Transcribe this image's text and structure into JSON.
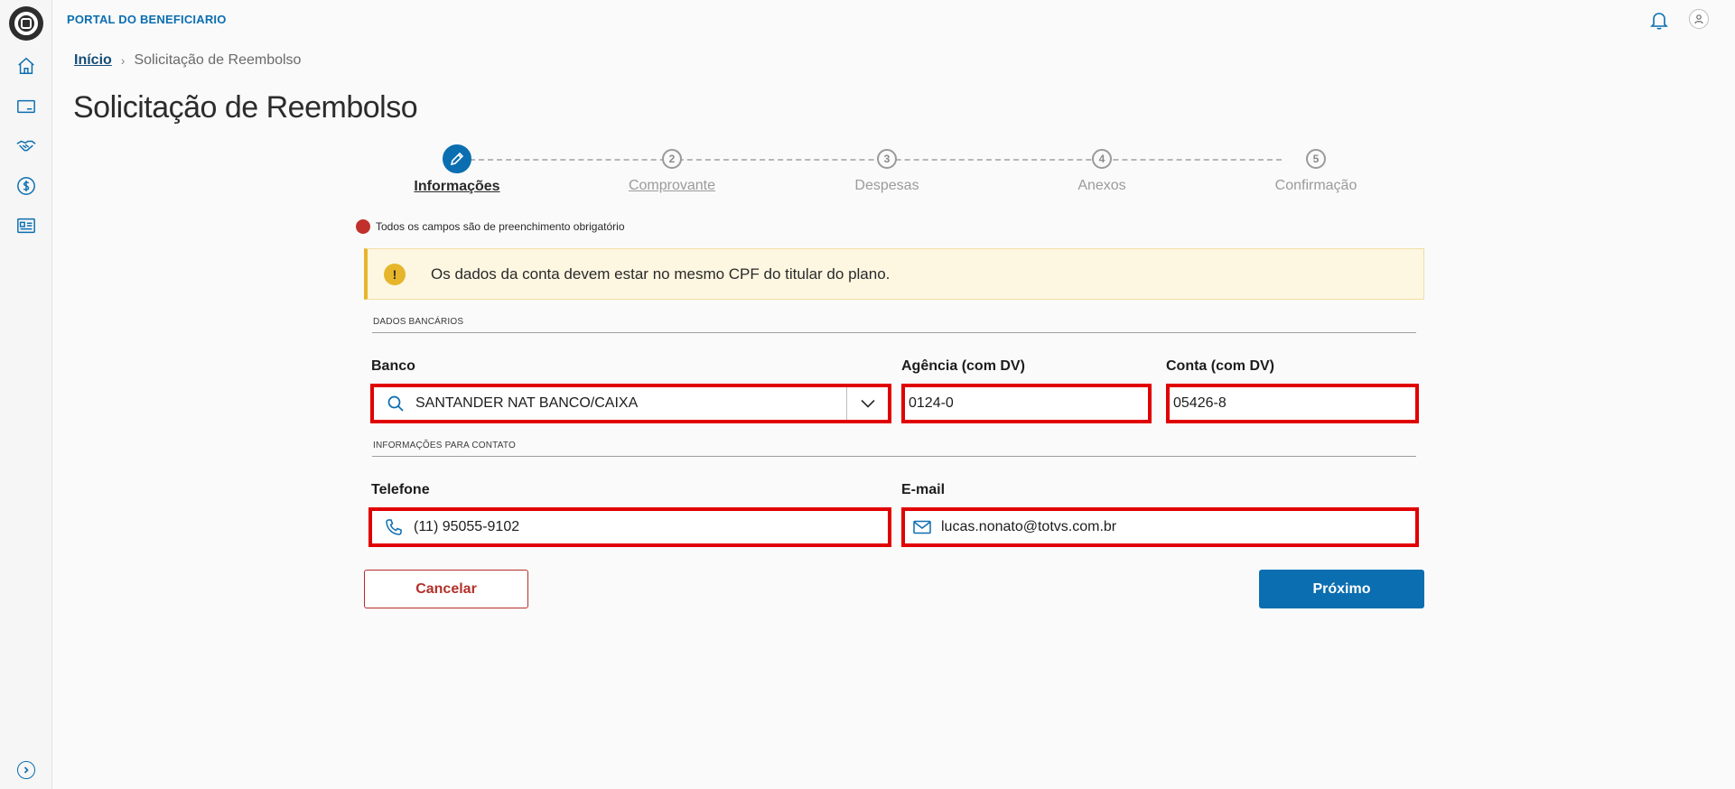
{
  "header": {
    "portal_title": "PORTAL DO BENEFICIARIO",
    "icons": [
      "logo-icon",
      "bell-icon",
      "user-icon"
    ]
  },
  "sidebar": {
    "items": [
      {
        "icon": "home-icon"
      },
      {
        "icon": "card-icon"
      },
      {
        "icon": "handshake-icon"
      },
      {
        "icon": "dollar-icon"
      },
      {
        "icon": "document-icon"
      }
    ],
    "expand_icon": "chevron-right-icon"
  },
  "breadcrumb": {
    "home": "Início",
    "current": "Solicitação de Reembolso"
  },
  "page": {
    "title": "Solicitação de Reembolso"
  },
  "stepper": {
    "steps": [
      {
        "number": "1",
        "label": "Informações",
        "state": "active"
      },
      {
        "number": "2",
        "label": "Comprovante",
        "state": "pending"
      },
      {
        "number": "3",
        "label": "Despesas",
        "state": "pending"
      },
      {
        "number": "4",
        "label": "Anexos",
        "state": "pending"
      },
      {
        "number": "5",
        "label": "Confirmação",
        "state": "pending"
      }
    ]
  },
  "form": {
    "required_note": "Todos os campos são de preenchimento obrigatório",
    "alert": {
      "icon": "!",
      "text": "Os dados da conta devem estar no mesmo CPF do titular do plano."
    },
    "bank_section": {
      "title": "DADOS BANCÁRIOS",
      "bank_label": "Banco",
      "bank_value": "SANTANDER NAT BANCO/CAIXA",
      "agency_label": "Agência (com DV)",
      "agency_value": "0124-0",
      "account_label": "Conta (com DV)",
      "account_value": "05426-8"
    },
    "contact_section": {
      "title": "INFORMAÇÕES PARA CONTATO",
      "phone_label": "Telefone",
      "phone_value": "(11) 95055-9102",
      "email_label": "E-mail",
      "email_value": "lucas.nonato@totvs.com.br"
    },
    "buttons": {
      "cancel": "Cancelar",
      "next": "Próximo"
    }
  },
  "colors": {
    "primary": "#0b6eb0",
    "danger": "#b3302a",
    "highlight": "#e10000",
    "warning": "#e7b52a",
    "warning_bg": "#fdf6e1"
  }
}
